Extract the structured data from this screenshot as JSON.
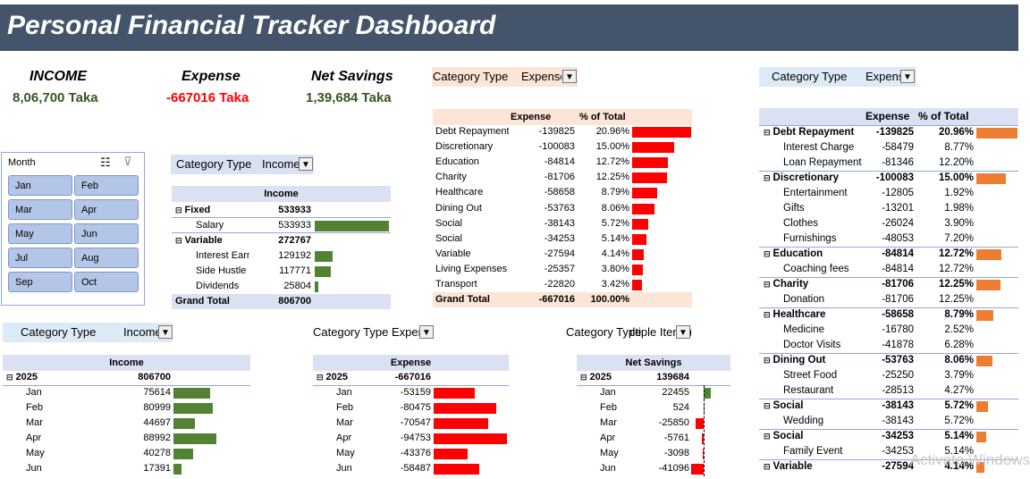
{
  "title": "Personal Financial Tracker Dashboard",
  "kpis": {
    "income_label": "INCOME",
    "income_value": "8,06,700 Taka",
    "expense_label": "Expense",
    "expense_value": "-667016 Taka",
    "savings_label": "Net Savings",
    "savings_value": "1,39,684 Taka"
  },
  "colors": {
    "income_bar": "#548235",
    "expense_bar": "#ff0000",
    "cat_bar": "#ed7d31",
    "kpi_green": "#375623",
    "kpi_red": "#ff0000",
    "banner": "#44546a"
  },
  "slicer": {
    "title": "Month",
    "months": [
      "Jan",
      "Feb",
      "Mar",
      "Apr",
      "May",
      "Jun",
      "Jul",
      "Aug",
      "Sep",
      "Oct"
    ]
  },
  "filter_labels": {
    "category_type": "Category Type",
    "income": "Income",
    "expense": "Expense",
    "multiple": "(Multiple Items)"
  },
  "income_pivot": {
    "header": "Income",
    "groups": [
      {
        "label": "Fixed",
        "value": "533933",
        "items": [
          {
            "label": "Salary",
            "value": "533933",
            "v": 533933
          }
        ]
      },
      {
        "label": "Variable",
        "value": "272767",
        "items": [
          {
            "label": "Interest Earned",
            "value": "129192",
            "v": 129192
          },
          {
            "label": "Side Hustle",
            "value": "117771",
            "v": 117771
          },
          {
            "label": "Dividends",
            "value": "25804",
            "v": 25804
          }
        ]
      }
    ],
    "total_label": "Grand Total",
    "total_value": "806700"
  },
  "expense_pivot": {
    "col_expense": "Expense",
    "col_pct": "% of Total",
    "rows": [
      {
        "label": "Debt Repayment",
        "value": "-139825",
        "pct": "20.96%",
        "v": 139825
      },
      {
        "label": "Discretionary",
        "value": "-100083",
        "pct": "15.00%",
        "v": 100083
      },
      {
        "label": "Education",
        "value": "-84814",
        "pct": "12.72%",
        "v": 84814
      },
      {
        "label": "Charity",
        "value": "-81706",
        "pct": "12.25%",
        "v": 81706
      },
      {
        "label": "Healthcare",
        "value": "-58658",
        "pct": "8.79%",
        "v": 58658
      },
      {
        "label": "Dining Out",
        "value": "-53763",
        "pct": "8.06%",
        "v": 53763
      },
      {
        "label": "Social",
        "value": "-38143",
        "pct": "5.72%",
        "v": 38143
      },
      {
        "label": "Social",
        "value": "-34253",
        "pct": "5.14%",
        "v": 34253
      },
      {
        "label": "Variable",
        "value": "-27594",
        "pct": "4.14%",
        "v": 27594
      },
      {
        "label": "Living Expenses",
        "value": "-25357",
        "pct": "3.80%",
        "v": 25357
      },
      {
        "label": "Transport",
        "value": "-22820",
        "pct": "3.42%",
        "v": 22820
      }
    ],
    "total_label": "Grand Total",
    "total_value": "-667016",
    "total_pct": "100.00%"
  },
  "detail_pivot": {
    "col_expense": "Expense",
    "col_pct": "% of Total",
    "rows": [
      {
        "label": "Debt Repayment",
        "value": "-139825",
        "pct": "20.96%",
        "group": true,
        "v": 139825
      },
      {
        "label": "Interest Charge",
        "value": "-58479",
        "pct": "8.77%"
      },
      {
        "label": "Loan Repayment",
        "value": "-81346",
        "pct": "12.20%"
      },
      {
        "label": "Discretionary",
        "value": "-100083",
        "pct": "15.00%",
        "group": true,
        "v": 100083
      },
      {
        "label": "Entertainment",
        "value": "-12805",
        "pct": "1.92%"
      },
      {
        "label": "Gifts",
        "value": "-13201",
        "pct": "1.98%"
      },
      {
        "label": "Clothes",
        "value": "-26024",
        "pct": "3.90%"
      },
      {
        "label": "Furnishings",
        "value": "-48053",
        "pct": "7.20%"
      },
      {
        "label": "Education",
        "value": "-84814",
        "pct": "12.72%",
        "group": true,
        "v": 84814
      },
      {
        "label": "Coaching fees",
        "value": "-84814",
        "pct": "12.72%"
      },
      {
        "label": "Charity",
        "value": "-81706",
        "pct": "12.25%",
        "group": true,
        "v": 81706
      },
      {
        "label": "Donation",
        "value": "-81706",
        "pct": "12.25%"
      },
      {
        "label": "Healthcare",
        "value": "-58658",
        "pct": "8.79%",
        "group": true,
        "v": 58658
      },
      {
        "label": "Medicine",
        "value": "-16780",
        "pct": "2.52%"
      },
      {
        "label": "Doctor Visits",
        "value": "-41878",
        "pct": "6.28%"
      },
      {
        "label": "Dining Out",
        "value": "-53763",
        "pct": "8.06%",
        "group": true,
        "v": 53763
      },
      {
        "label": "Street Food",
        "value": "-25250",
        "pct": "3.79%"
      },
      {
        "label": "Restaurant",
        "value": "-28513",
        "pct": "4.27%"
      },
      {
        "label": "Social",
        "value": "-38143",
        "pct": "5.72%",
        "group": true,
        "v": 38143
      },
      {
        "label": "Wedding",
        "value": "-38143",
        "pct": "5.72%"
      },
      {
        "label": "Social",
        "value": "-34253",
        "pct": "5.14%",
        "group": true,
        "v": 34253
      },
      {
        "label": "Family Event",
        "value": "-34253",
        "pct": "5.14%"
      },
      {
        "label": "Variable",
        "value": "-27594",
        "pct": "4.14%",
        "group": true,
        "v": 27594
      }
    ]
  },
  "monthly_income": {
    "header": "Income",
    "year": "2025",
    "year_total": "806700",
    "months": [
      {
        "label": "Jan",
        "value": "75614",
        "v": 75614
      },
      {
        "label": "Feb",
        "value": "80999",
        "v": 80999
      },
      {
        "label": "Mar",
        "value": "44697",
        "v": 44697
      },
      {
        "label": "Apr",
        "value": "88992",
        "v": 88992
      },
      {
        "label": "May",
        "value": "40278",
        "v": 40278
      },
      {
        "label": "Jun",
        "value": "17391",
        "v": 17391
      }
    ]
  },
  "monthly_expense": {
    "header": "Expense",
    "year": "2025",
    "year_total": "-667016",
    "months": [
      {
        "label": "Jan",
        "value": "-53159",
        "v": 53159
      },
      {
        "label": "Feb",
        "value": "-80475",
        "v": 80475
      },
      {
        "label": "Mar",
        "value": "-70547",
        "v": 70547
      },
      {
        "label": "Apr",
        "value": "-94753",
        "v": 94753
      },
      {
        "label": "May",
        "value": "-43376",
        "v": 43376
      },
      {
        "label": "Jun",
        "value": "-58487",
        "v": 58487
      }
    ]
  },
  "monthly_savings": {
    "header": "Net Savings",
    "year": "2025",
    "year_total": "139684",
    "months": [
      {
        "label": "Jan",
        "value": "22455",
        "v": 22455
      },
      {
        "label": "Feb",
        "value": "524",
        "v": 524
      },
      {
        "label": "Mar",
        "value": "-25850",
        "v": -25850
      },
      {
        "label": "Apr",
        "value": "-5761",
        "v": -5761
      },
      {
        "label": "May",
        "value": "-3098",
        "v": -3098
      },
      {
        "label": "Jun",
        "value": "-41096",
        "v": -41096
      }
    ]
  },
  "watermark": "Activate Windows"
}
